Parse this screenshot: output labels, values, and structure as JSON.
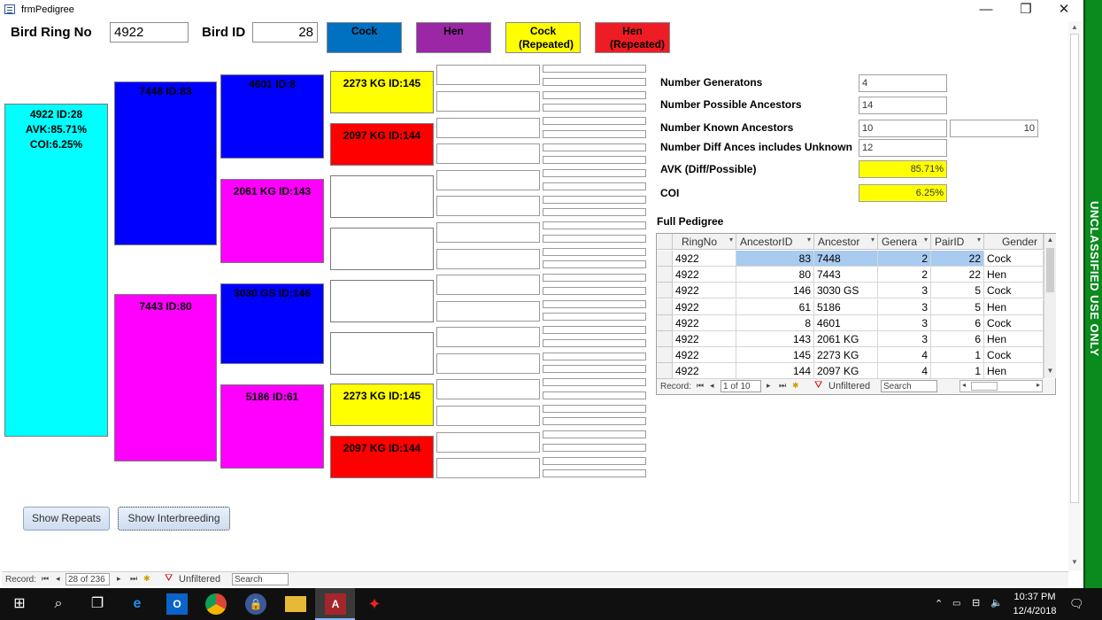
{
  "window": {
    "title": "frmPedigree",
    "buttons": {
      "minimize": "—",
      "restore": "❐",
      "close": "✕"
    }
  },
  "header": {
    "ring_label": "Bird Ring No",
    "ring_value": "4922",
    "id_label": "Bird ID",
    "id_value": "28"
  },
  "legend": [
    {
      "label": "Cock",
      "color": "#0070c0"
    },
    {
      "label": "Hen",
      "color": "#9b26a6"
    },
    {
      "label": "Cock (Repeated)",
      "color": "#ffff00"
    },
    {
      "label": "Hen (Repeated)",
      "color": "#ee1c24"
    }
  ],
  "pedigree": {
    "subject": {
      "line1": "4922 ID:28",
      "line2": "AVK:85.71%",
      "line3": "COI:6.25%"
    },
    "sire": "7448 ID:83",
    "dam": "7443 ID:80",
    "sire_sire": "4601 ID:8",
    "sire_dam": "2061 KG ID:143",
    "dam_sire": "3030 GS ID:146",
    "dam_dam": "5186 ID:61",
    "g4_1": "2273 KG ID:145",
    "g4_2": "2097 KG ID:144",
    "g4_3": "",
    "g4_4": "",
    "g4_5": "",
    "g4_6": "",
    "g4_7": "2273 KG ID:145",
    "g4_8": "2097 KG ID:144"
  },
  "stats": {
    "generations_label": "Number Generatons",
    "generations": "4",
    "possible_label": "Number Possible Ancestors",
    "possible": "14",
    "known_label": "Number Known Ancestors",
    "known": "10",
    "known_right": "10",
    "diff_label": "Number  Diff Ances includes Unknown",
    "diff": "12",
    "avk_label": "AVK (Diff/Possible)",
    "avk": "85.71%",
    "coi_label": "COI",
    "coi": "6.25%"
  },
  "grid": {
    "title": "Full Pedigree",
    "columns": [
      "RingNo",
      "AncestorID",
      "Ancestor",
      "Genera",
      "PairID",
      "Gender"
    ],
    "rows": [
      [
        "4922",
        "83",
        "7448",
        "2",
        "22",
        "Cock"
      ],
      [
        "4922",
        "80",
        "7443",
        "2",
        "22",
        "Hen"
      ],
      [
        "4922",
        "146",
        "3030 GS",
        "3",
        "5",
        "Cock"
      ],
      [
        "4922",
        "61",
        "5186",
        "3",
        "5",
        "Hen"
      ],
      [
        "4922",
        "8",
        "4601",
        "3",
        "6",
        "Cock"
      ],
      [
        "4922",
        "143",
        "2061 KG",
        "3",
        "6",
        "Hen"
      ],
      [
        "4922",
        "145",
        "2273 KG",
        "4",
        "1",
        "Cock"
      ],
      [
        "4922",
        "144",
        "2097 KG",
        "4",
        "1",
        "Hen"
      ]
    ],
    "nav": {
      "label": "Record:",
      "position": "1 of 10",
      "filter": "Unfiltered",
      "search": "Search"
    }
  },
  "buttons": {
    "show_repeats": "Show Repeats",
    "show_interbreeding": "Show Interbreeding"
  },
  "form_nav": {
    "label": "Record:",
    "position": "28 of 236",
    "filter": "Unfiltered",
    "search": "Search"
  },
  "banner": "UNCLASSIFIED USE ONLY",
  "taskbar": {
    "time": "10:37 PM",
    "date": "12/4/2018"
  }
}
